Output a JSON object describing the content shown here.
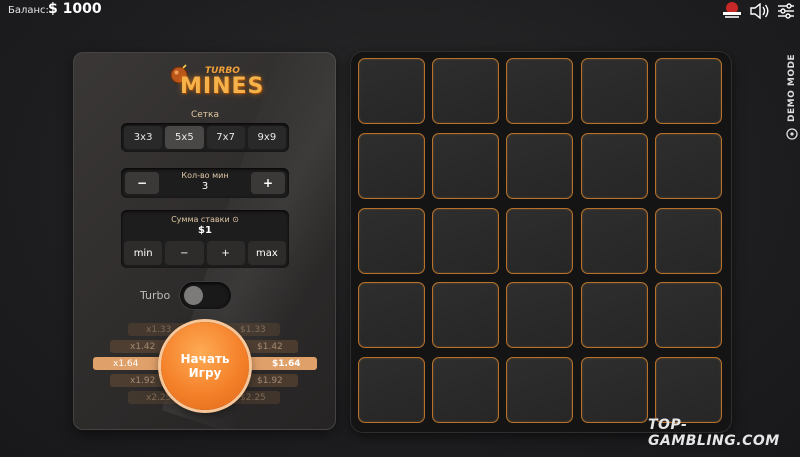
{
  "header": {
    "balance_label": "Баланс:",
    "balance_value": "$ 1000"
  },
  "logo": {
    "turbo": "TURBO",
    "mines": "MINES"
  },
  "grid_size": {
    "label": "Сетка",
    "options": [
      "3x3",
      "5x5",
      "7x7",
      "9x9"
    ],
    "selected": "5x5"
  },
  "mines": {
    "label": "Кол-во мин",
    "value": "3",
    "minus": "−",
    "plus": "+"
  },
  "bet": {
    "label": "Сумма ставки ⊙",
    "value": "$1",
    "buttons": [
      "min",
      "−",
      "+",
      "max"
    ]
  },
  "turbo": {
    "label": "Turbo",
    "enabled": false
  },
  "odds": {
    "left": [
      "x1.33",
      "x1.42",
      "x1.64",
      "x1.92",
      "x2.25"
    ],
    "right": [
      "$1.33",
      "$1.42",
      "$1.64",
      "$1.92",
      "$2.25"
    ],
    "highlighted_left": "x1.64",
    "highlighted_right": "$1.64"
  },
  "start_button": {
    "line1": "Начать",
    "line2": "Игру"
  },
  "board": {
    "rows": 5,
    "cols": 5
  },
  "side": {
    "demo_mode": "DEMO MODE"
  },
  "watermark": "TOP-GAMBLING.COM",
  "colors": {
    "accent": "#f4812a",
    "cell_border": "#b6712a",
    "board_bg": "#141414"
  }
}
